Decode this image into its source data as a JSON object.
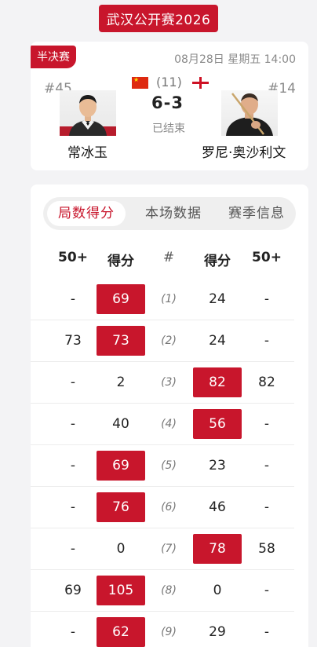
{
  "header": {
    "title": "武汉公开赛2026"
  },
  "match": {
    "round": "半决赛",
    "date": "08月28日 星期五 14:00",
    "left_player": {
      "seed": "#45",
      "name": "常冰玉"
    },
    "right_player": {
      "seed": "#14",
      "name": "罗尼·奥沙利文"
    },
    "frames_total": "(11)",
    "score": "6-3",
    "status": "已结束",
    "colors": {
      "accent": "#c8162c"
    }
  },
  "tabs": {
    "items": [
      "局数得分",
      "本场数据",
      "赛季信息"
    ],
    "active": 0
  },
  "table": {
    "headers": [
      "50+",
      "得分",
      "#",
      "得分",
      "50+"
    ],
    "rows": [
      {
        "l50": "-",
        "lscore": "69",
        "frame": "(1)",
        "rscore": "24",
        "r50": "-",
        "winner": "left"
      },
      {
        "l50": "73",
        "lscore": "73",
        "frame": "(2)",
        "rscore": "24",
        "r50": "-",
        "winner": "left"
      },
      {
        "l50": "-",
        "lscore": "2",
        "frame": "(3)",
        "rscore": "82",
        "r50": "82",
        "winner": "right"
      },
      {
        "l50": "-",
        "lscore": "40",
        "frame": "(4)",
        "rscore": "56",
        "r50": "-",
        "winner": "right"
      },
      {
        "l50": "-",
        "lscore": "69",
        "frame": "(5)",
        "rscore": "23",
        "r50": "-",
        "winner": "left"
      },
      {
        "l50": "-",
        "lscore": "76",
        "frame": "(6)",
        "rscore": "46",
        "r50": "-",
        "winner": "left"
      },
      {
        "l50": "-",
        "lscore": "0",
        "frame": "(7)",
        "rscore": "78",
        "r50": "58",
        "winner": "right"
      },
      {
        "l50": "69",
        "lscore": "105",
        "frame": "(8)",
        "rscore": "0",
        "r50": "-",
        "winner": "left"
      },
      {
        "l50": "-",
        "lscore": "62",
        "frame": "(9)",
        "rscore": "29",
        "r50": "-",
        "winner": "left"
      }
    ]
  }
}
